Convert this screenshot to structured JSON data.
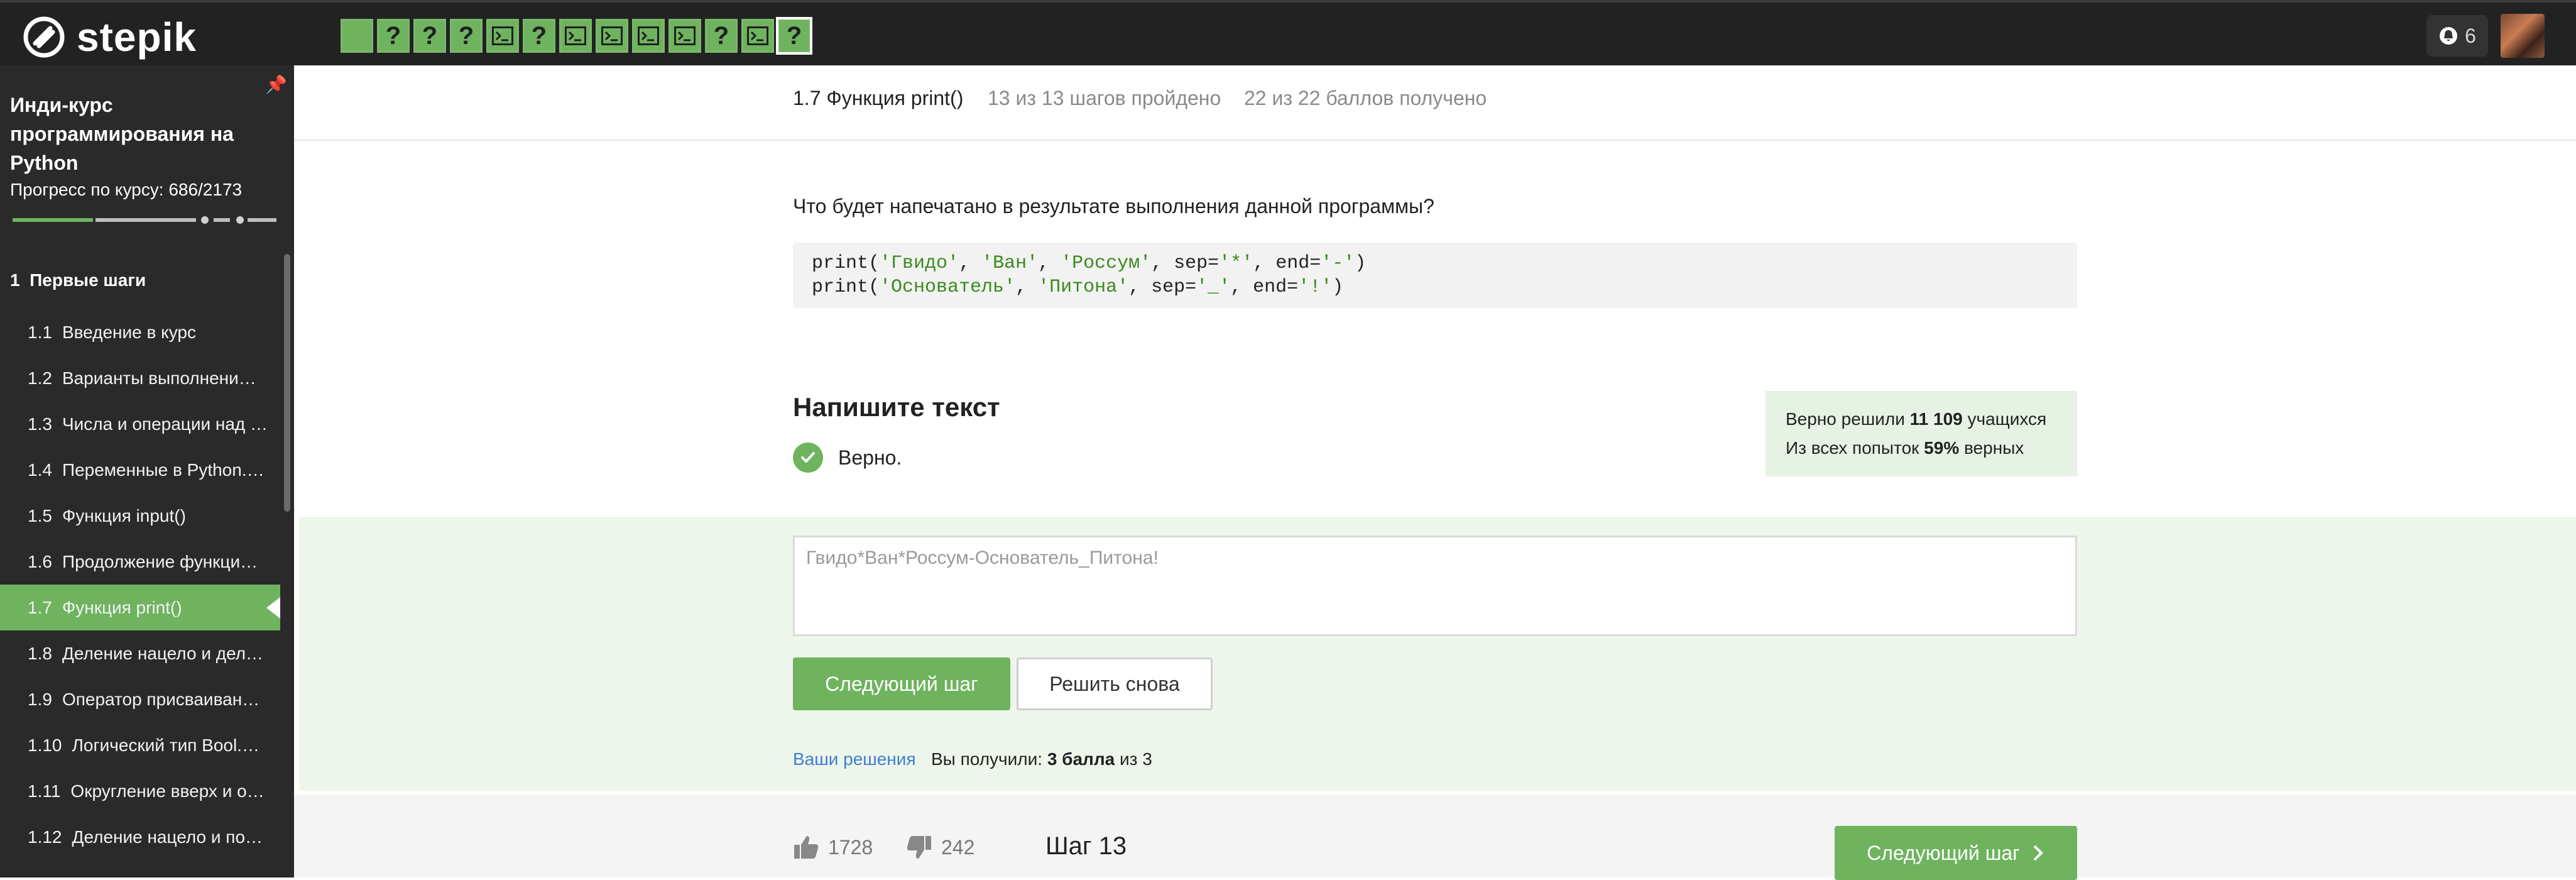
{
  "app": {
    "name": "stepik",
    "accent_color": "#6fb35f"
  },
  "topbar": {
    "steps": [
      {
        "kind": "done",
        "icon": ""
      },
      {
        "kind": "quiz",
        "icon": "?"
      },
      {
        "kind": "quiz",
        "icon": "?"
      },
      {
        "kind": "quiz",
        "icon": "?"
      },
      {
        "kind": "code",
        "icon": "terminal-icon"
      },
      {
        "kind": "quiz",
        "icon": "?"
      },
      {
        "kind": "code",
        "icon": "terminal-icon"
      },
      {
        "kind": "code",
        "icon": "terminal-icon"
      },
      {
        "kind": "code",
        "icon": "terminal-icon"
      },
      {
        "kind": "code",
        "icon": "terminal-icon"
      },
      {
        "kind": "quiz",
        "icon": "?"
      },
      {
        "kind": "code",
        "icon": "terminal-icon"
      },
      {
        "kind": "quiz",
        "icon": "?",
        "current": true
      }
    ],
    "notifications_count": "6"
  },
  "sidebar": {
    "course_title": "Инди-курс программирования на Python",
    "progress_label": "Прогресс по курсу:",
    "progress_value": "686/2173",
    "section": {
      "number": "1",
      "title": "Первые шаги"
    },
    "lessons": [
      {
        "num": "1.1",
        "title": "Введение в курс"
      },
      {
        "num": "1.2",
        "title": "Варианты выполнени…"
      },
      {
        "num": "1.3",
        "title": "Числа и операции над …"
      },
      {
        "num": "1.4",
        "title": "Переменные в Python.…"
      },
      {
        "num": "1.5",
        "title": "Функция input()"
      },
      {
        "num": "1.6",
        "title": "Продолжение функци…"
      },
      {
        "num": "1.7",
        "title": "Функция print()",
        "active": true
      },
      {
        "num": "1.8",
        "title": "Деление нацело и дел…"
      },
      {
        "num": "1.9",
        "title": "Оператор присваиван…"
      },
      {
        "num": "1.10",
        "title": "Логический тип Bool.…"
      },
      {
        "num": "1.11",
        "title": "Округление вверх и о…"
      },
      {
        "num": "1.12",
        "title": "Деление нацело и по…"
      }
    ]
  },
  "header": {
    "lesson_title": "1.7 Функция print()",
    "steps_passed": "13 из 13 шагов пройдено",
    "points": "22 из 22 баллов  получено"
  },
  "content": {
    "question": "Что будет напечатано в результате выполнения данной программы?",
    "code_lines": [
      [
        [
          "t",
          "print("
        ],
        [
          "s",
          "'Гвидо'"
        ],
        [
          "t",
          ", "
        ],
        [
          "s",
          "'Ван'"
        ],
        [
          "t",
          ", "
        ],
        [
          "s",
          "'Россум'"
        ],
        [
          "t",
          ", sep="
        ],
        [
          "s",
          "'*'"
        ],
        [
          "t",
          ", end="
        ],
        [
          "s",
          "'-'"
        ],
        [
          "t",
          ")"
        ]
      ],
      [
        [
          "t",
          "print("
        ],
        [
          "s",
          "'Основатель'"
        ],
        [
          "t",
          ", "
        ],
        [
          "s",
          "'Питона'"
        ],
        [
          "t",
          ", sep="
        ],
        [
          "s",
          "'_'"
        ],
        [
          "t",
          ", end="
        ],
        [
          "s",
          "'!'"
        ],
        [
          "t",
          ")"
        ]
      ]
    ],
    "task_title": "Напишите текст",
    "verdict": "Верно.",
    "stats": {
      "solved_prefix": "Верно решили ",
      "solved_count": "11 109",
      "solved_suffix": " учащихся",
      "attempts_prefix": "Из всех попыток ",
      "attempts_percent": "59%",
      "attempts_suffix": " верных"
    },
    "answer_text": "Гвидо*Ван*Россум-Основатель_Питона!",
    "next_button": "Следующий шаг",
    "retry_button": "Решить снова",
    "solutions_link": "Ваши решения",
    "score_prefix": "Вы получили: ",
    "score_value": "3 балла",
    "score_suffix": " из 3"
  },
  "footer": {
    "likes": "1728",
    "dislikes": "242",
    "step_label": "Шаг 13",
    "next_button": "Следующий шаг"
  }
}
